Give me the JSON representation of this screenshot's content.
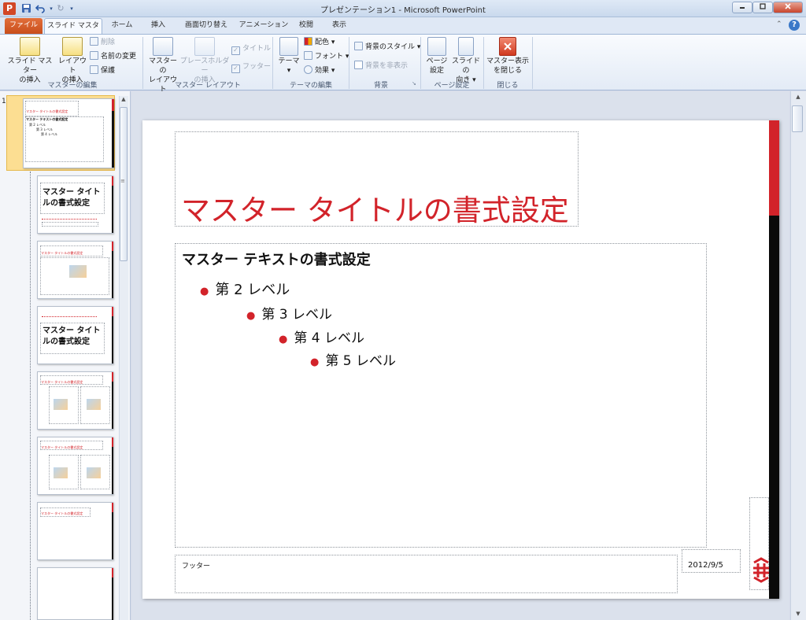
{
  "window": {
    "title": "プレゼンテーション1 - Microsoft PowerPoint",
    "app_icon": "P"
  },
  "tabs": [
    "ファイル",
    "スライド マスター",
    "ホーム",
    "挿入",
    "画面切り替え",
    "アニメーション",
    "校閲",
    "表示"
  ],
  "ribbon": {
    "groups": [
      {
        "label": "マスターの編集"
      },
      {
        "label": "マスター レイアウト"
      },
      {
        "label": "テーマの編集"
      },
      {
        "label": "背景"
      },
      {
        "label": "ページ設定"
      },
      {
        "label": "閉じる"
      }
    ],
    "insert_master": [
      "スライド マスター",
      "の挿入"
    ],
    "insert_layout": [
      "レイアウト",
      "の挿入"
    ],
    "delete": "削除",
    "rename": "名前の変更",
    "preserve": "保護",
    "master_layout": [
      "マスターの",
      "レイアウト"
    ],
    "insert_placeholder": [
      "プレースホルダー",
      "の挿入"
    ],
    "title_check": "タイトル",
    "footer_check": "フッター",
    "themes": "テーマ",
    "colors": "配色",
    "fonts": "フォント",
    "effects": "効果",
    "bg_styles": "背景のスタイル",
    "hide_bg": "背景を非表示",
    "page_setup": [
      "ページ",
      "設定"
    ],
    "slide_orientation": [
      "スライドの",
      "向き"
    ],
    "close_master": [
      "マスター表示",
      "を閉じる"
    ]
  },
  "thumbnails": {
    "number": "1",
    "master_title_small": "マスター タイトルの書式設定",
    "master_text_small": "マスター テキストの書式設定",
    "level2_small": "第 2 レベル",
    "level3_small": "第 3 レベル",
    "level4_small": "第 4 レベル",
    "title_layout_text": "マスター タイトルの書式設定"
  },
  "slide": {
    "title": "マスター タイトルの書式設定",
    "body_level1": "マスター テキストの書式設定",
    "levels": [
      "第 2 レベル",
      "第 3 レベル",
      "第 4 レベル",
      "第 5 レベル"
    ],
    "footer": "フッター",
    "date": "2012/9/5"
  },
  "colors": {
    "accent_red": "#d2232a",
    "file_tab": "#d2541f"
  }
}
